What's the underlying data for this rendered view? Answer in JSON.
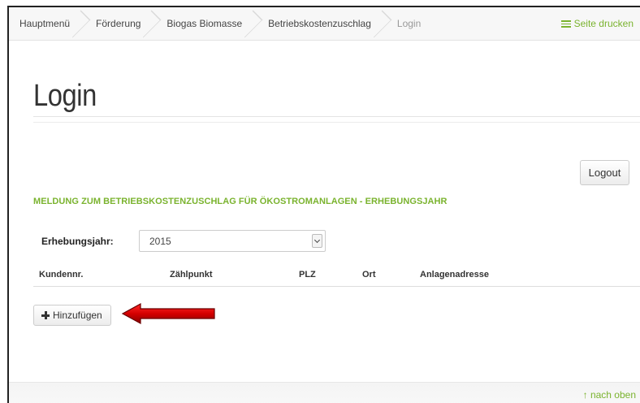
{
  "breadcrumb": {
    "items": [
      {
        "label": "Hauptmenü"
      },
      {
        "label": "Förderung"
      },
      {
        "label": "Biogas Biomasse"
      },
      {
        "label": "Betriebskostenzuschlag"
      },
      {
        "label": "Login"
      }
    ],
    "print_label": "Seite drucken"
  },
  "page": {
    "title": "Login",
    "logout_label": "Logout",
    "section_heading": "MELDUNG ZUM BETRIEBSKOSTENZUSCHLAG FÜR ÖKOSTROMANLAGEN - ERHEBUNGSJAHR"
  },
  "form": {
    "year_label": "Erhebungsjahr:",
    "year_value": "2015"
  },
  "table": {
    "columns": [
      "Kundennr.",
      "Zählpunkt",
      "PLZ",
      "Ort",
      "Anlagenadresse"
    ]
  },
  "actions": {
    "add_label": "Hinzufügen"
  },
  "footer": {
    "to_top_label": "↑ nach oben"
  },
  "colors": {
    "accent": "#7ab32e",
    "annotation_arrow": "#d00000"
  }
}
